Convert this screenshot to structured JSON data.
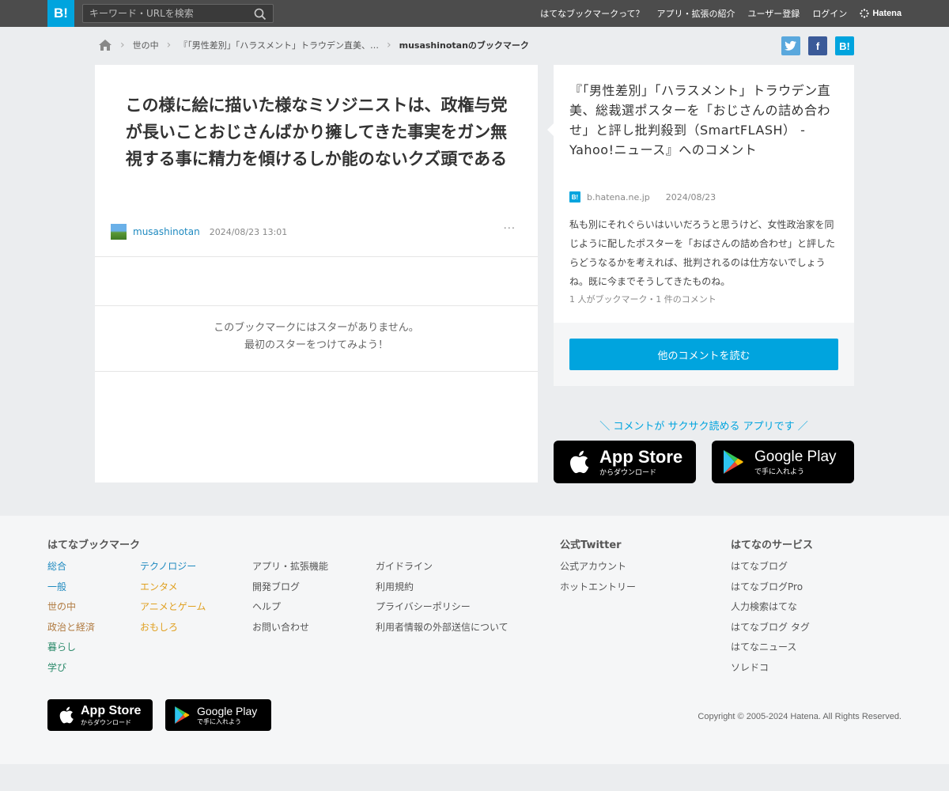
{
  "header": {
    "logo": "B!",
    "search_placeholder": "キーワード・URLを検索",
    "nav": [
      "はてなブックマークって？",
      "アプリ・拡張の紹介",
      "ユーザー登録",
      "ログイン"
    ],
    "brand": "Hatena"
  },
  "breadcrumb": {
    "items": [
      "世の中",
      "『「男性差別」「ハラスメント」トラウデン直美、…"
    ],
    "current": "musashinotanのブックマーク"
  },
  "share": {
    "twitter": "t",
    "facebook": "f",
    "hatena": "B!"
  },
  "comment": {
    "text": "この様に絵に描いた様なミソジニストは、政権与党が長いことおじさんばかり擁してきた事実をガン無視する事に精力を傾けるしか能のないクズ頭である",
    "user": "musashinotan",
    "date": "2024/08/23 13:01",
    "more": "···",
    "stars_line1": "このブックマークにはスターがありません。",
    "stars_line2": "最初のスターをつけてみよう！"
  },
  "entry": {
    "title": "『「男性差別」「ハラスメント」トラウデン直美、総裁選ポスターを「おじさんの詰め合わせ」と評し批判殺到（SmartFLASH） - Yahoo!ニュース』へのコメント",
    "favicon": "B!",
    "domain": "b.hatena.ne.jp",
    "date": "2024/08/23",
    "description": "私も別にそれぐらいはいいだろうと思うけど、女性政治家を同じように配したポスターを「おばさんの詰め合わせ」と評したらどうなるかを考えれば、批判されるのは仕方ないでしょうね。既に今までそうしてきたものね。",
    "stats": "1 人がブックマーク・1 件のコメント",
    "read_button": "他のコメントを読む"
  },
  "promo": {
    "text": "＼ コメントが サクサク読める アプリです ／",
    "appstore_big": "App Store",
    "appstore_small": "からダウンロード",
    "googleplay_big": "Google Play",
    "googleplay_small": "で手に入れよう"
  },
  "footer": {
    "bookmark_heading": "はてなブックマーク",
    "col1": [
      "総合",
      "一般",
      "世の中",
      "政治と経済",
      "暮らし",
      "学び"
    ],
    "col2": [
      "テクノロジー",
      "エンタメ",
      "アニメとゲーム",
      "おもしろ"
    ],
    "col3": [
      "アプリ・拡張機能",
      "開発ブログ",
      "ヘルプ",
      "お問い合わせ"
    ],
    "col4": [
      "ガイドライン",
      "利用規約",
      "プライバシーポリシー",
      "利用者情報の外部送信について"
    ],
    "twitter_heading": "公式Twitter",
    "twitter_links": [
      "公式アカウント",
      "ホットエントリー"
    ],
    "services_heading": "はてなのサービス",
    "services": [
      "はてなブログ",
      "はてなブログPro",
      "人力検索はてな",
      "はてなブログ タグ",
      "はてなニュース",
      "ソレドコ"
    ],
    "copyright": "Copyright © 2005-2024 Hatena. All Rights Reserved.",
    "appstore_big": "App Store",
    "appstore_small": "からダウンロード",
    "googleplay_big": "Google Play",
    "googleplay_small": "で手に入れよう"
  },
  "colors": {
    "brand": "#00a4de",
    "header_bg": "#4c4c4c",
    "link": "#1f8ac0"
  }
}
